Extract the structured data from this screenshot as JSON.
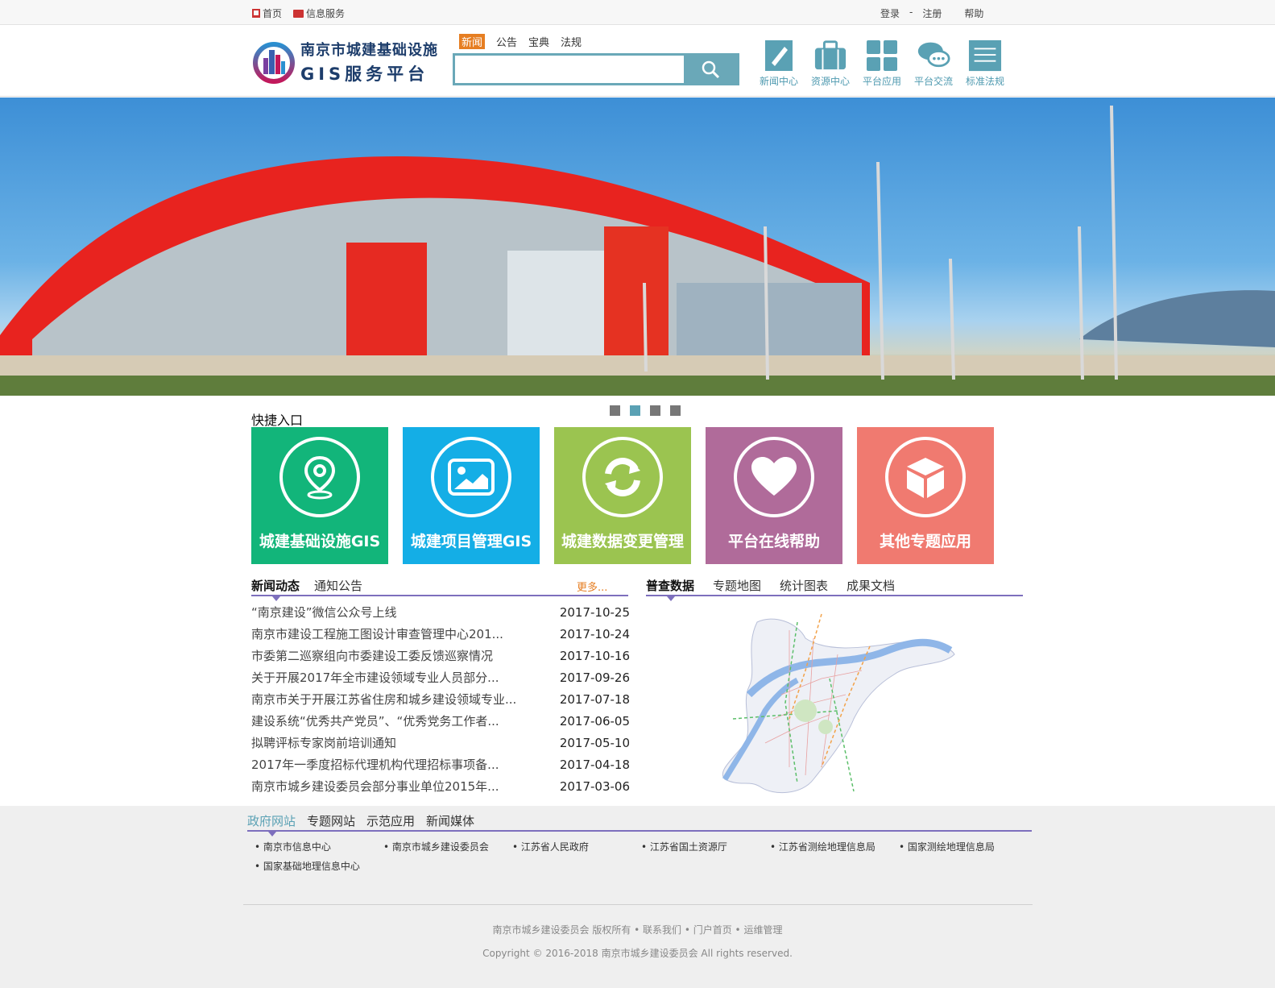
{
  "topbar": {
    "home": "首页",
    "info_service": "信息服务",
    "login": "登录",
    "sep": "-",
    "register": "注册",
    "help": "帮助"
  },
  "logo": {
    "line1": "南京市城建基础设施",
    "line2": "GIS服务平台"
  },
  "search": {
    "tabs": [
      "新闻",
      "公告",
      "宝典",
      "法规"
    ],
    "active_tab": "新闻",
    "placeholder": "",
    "icon": "search-icon"
  },
  "nav": [
    {
      "label": "新闻中心",
      "icon": "pen-doc-icon"
    },
    {
      "label": "资源中心",
      "icon": "briefcase-icon"
    },
    {
      "label": "平台应用",
      "icon": "grid-icon"
    },
    {
      "label": "平台交流",
      "icon": "chat-bubbles-icon"
    },
    {
      "label": "标准法规",
      "icon": "list-lines-icon"
    }
  ],
  "banner": {
    "slides": 4,
    "active_slide": 2
  },
  "quick": {
    "title": "快捷入口",
    "tiles": [
      {
        "label": "城建基础设施GIS",
        "icon": "location-pin-icon",
        "color": "#12b57a"
      },
      {
        "label": "城建项目管理GIS",
        "icon": "image-icon",
        "color": "#14aee6"
      },
      {
        "label": "城建数据变更管理",
        "icon": "refresh-icon",
        "color": "#9bc450"
      },
      {
        "label": "平台在线帮助",
        "icon": "heart-icon",
        "color": "#b06b9a"
      },
      {
        "label": "其他专题应用",
        "icon": "cube-icon",
        "color": "#f07a70"
      }
    ]
  },
  "news": {
    "tabs": [
      "新闻动态",
      "通知公告"
    ],
    "more": "更多...",
    "items": [
      {
        "title": "“南京建设”微信公众号上线",
        "date": "2017-10-25"
      },
      {
        "title": "南京市建设工程施工图设计审查管理中心201...",
        "date": "2017-10-24"
      },
      {
        "title": "市委第二巡察组向市委建设工委反馈巡察情况",
        "date": "2017-10-16"
      },
      {
        "title": "关于开展2017年全市建设领域专业人员部分...",
        "date": "2017-09-26"
      },
      {
        "title": "南京市关于开展江苏省住房和城乡建设领域专业...",
        "date": "2017-07-18"
      },
      {
        "title": "建设系统“优秀共产党员”、“优秀党务工作者...",
        "date": "2017-06-05"
      },
      {
        "title": "拟聘评标专家岗前培训通知",
        "date": "2017-05-10"
      },
      {
        "title": "2017年一季度招标代理机构代理招标事项备...",
        "date": "2017-04-18"
      },
      {
        "title": "南京市城乡建设委员会部分事业单位2015年...",
        "date": "2017-03-06"
      }
    ]
  },
  "data_tabs": [
    "普查数据",
    "专题地图",
    "统计图表",
    "成果文档"
  ],
  "links": {
    "tabs": [
      "政府网站",
      "专题网站",
      "示范应用",
      "新闻媒体"
    ],
    "items": [
      "南京市信息中心",
      "南京市城乡建设委员会",
      "江苏省人民政府",
      "江苏省国土资源厅",
      "江苏省测绘地理信息局",
      "国家测绘地理信息局",
      "国家基础地理信息中心"
    ]
  },
  "footer": {
    "line1": "南京市城乡建设委员会 版权所有 • 联系我们 • 门户首页 • 运维管理",
    "line2": "Copyright © 2016-2018 南京市城乡建设委员会 All rights reserved."
  }
}
